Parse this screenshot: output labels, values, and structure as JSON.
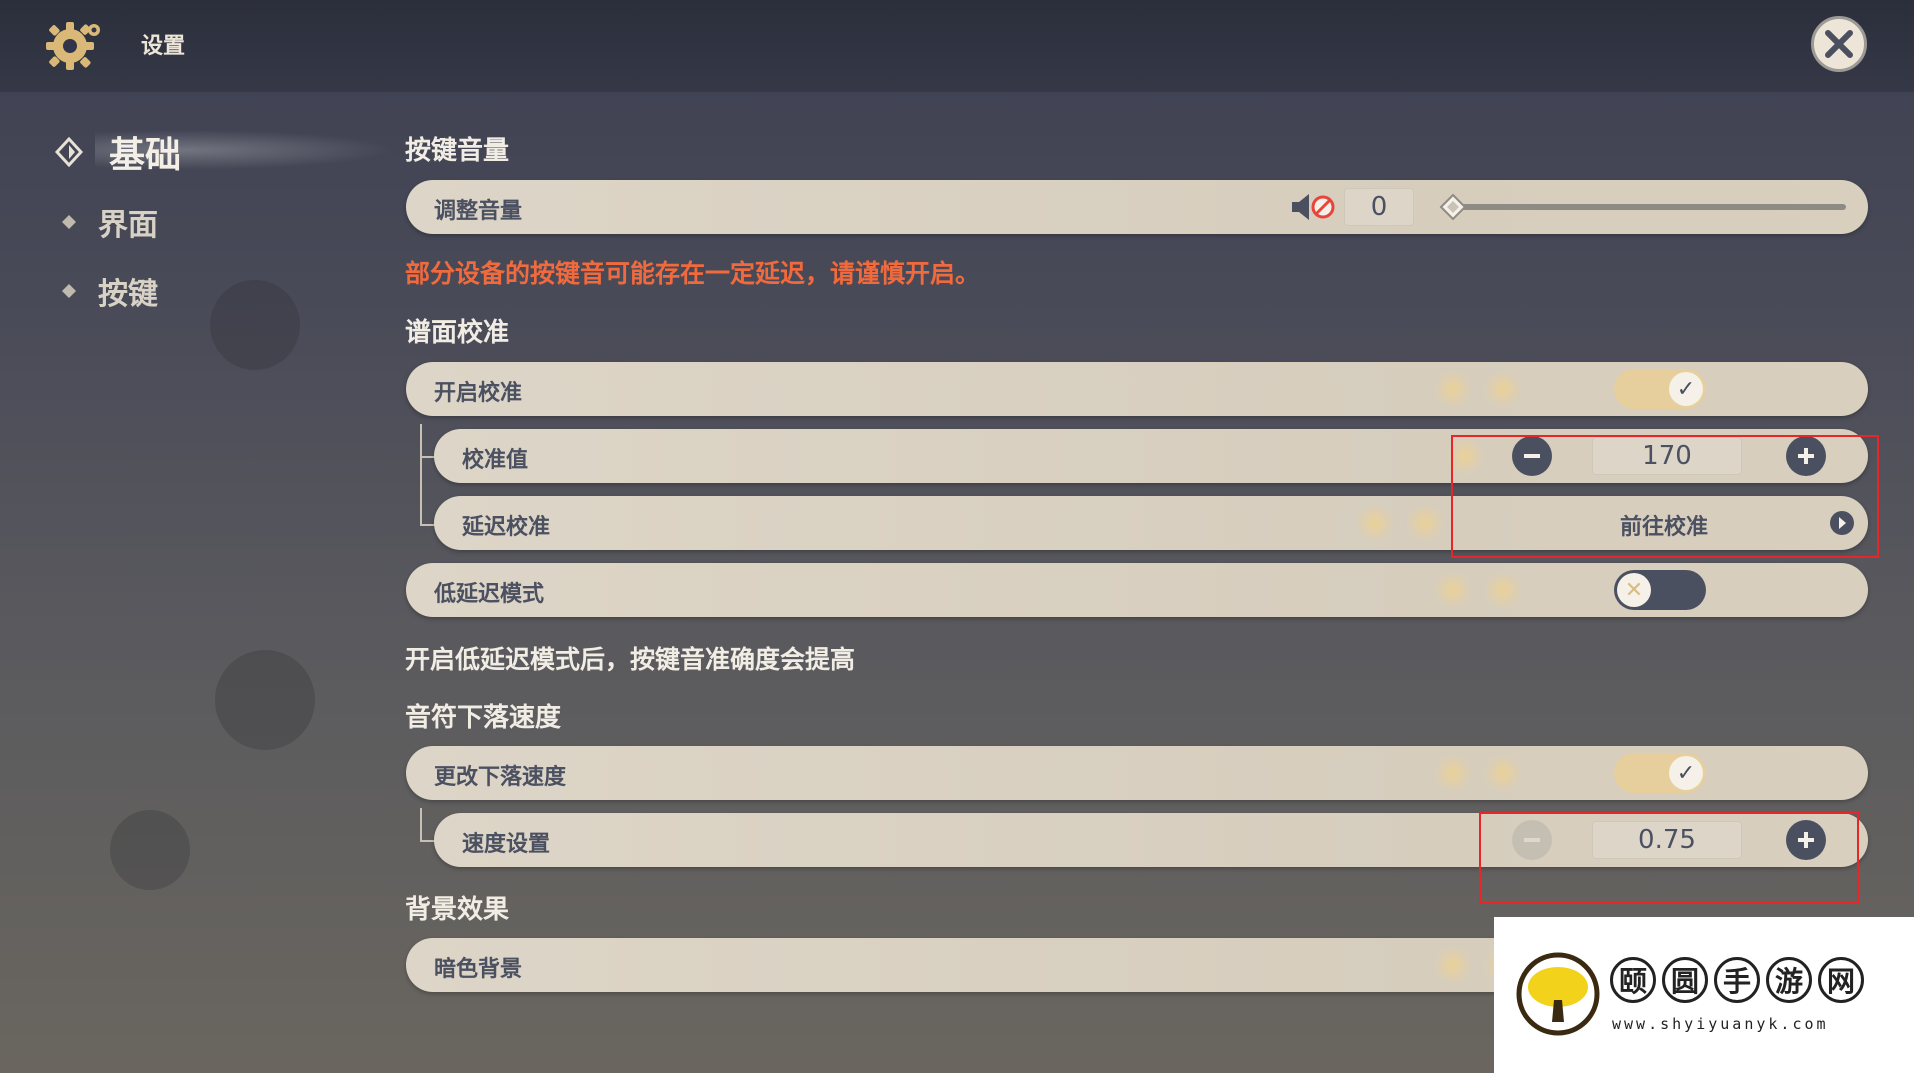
{
  "header": {
    "title": "设置",
    "icons": {
      "gear": "gear-icon",
      "close": "close-icon"
    }
  },
  "nav": {
    "items": [
      {
        "label": "基础",
        "active": true
      },
      {
        "label": "界面",
        "active": false
      },
      {
        "label": "按键",
        "active": false
      }
    ]
  },
  "sections": {
    "key_volume": {
      "title": "按键音量",
      "adjust_label": "调整音量",
      "volume_value": "0",
      "slider_value": 0,
      "muted": true,
      "warning": "部分设备的按键音可能存在一定延迟，请谨慎开启。"
    },
    "calibration": {
      "title": "谱面校准",
      "enable_label": "开启校准",
      "enable_on": true,
      "value_label": "校准值",
      "value": "170",
      "delay_label": "延迟校准",
      "delay_action": "前往校准",
      "low_latency_label": "低延迟模式",
      "low_latency_on": false,
      "note": "开启低延迟模式后，按键音准确度会提高"
    },
    "fall_speed": {
      "title": "音符下落速度",
      "change_label": "更改下落速度",
      "change_on": true,
      "speed_label": "速度设置",
      "speed_value": "0.75"
    },
    "background": {
      "title": "背景效果",
      "dark_label": "暗色背景"
    }
  },
  "watermark": {
    "chars": [
      "颐",
      "圆",
      "手",
      "游",
      "网"
    ],
    "url": "www.shyiyuanyk.com"
  },
  "colors": {
    "accent_gold": "#e6cf9c",
    "dark_slate": "#4b5061",
    "warning": "#f06a3d",
    "highlight_box": "#e8262a"
  }
}
